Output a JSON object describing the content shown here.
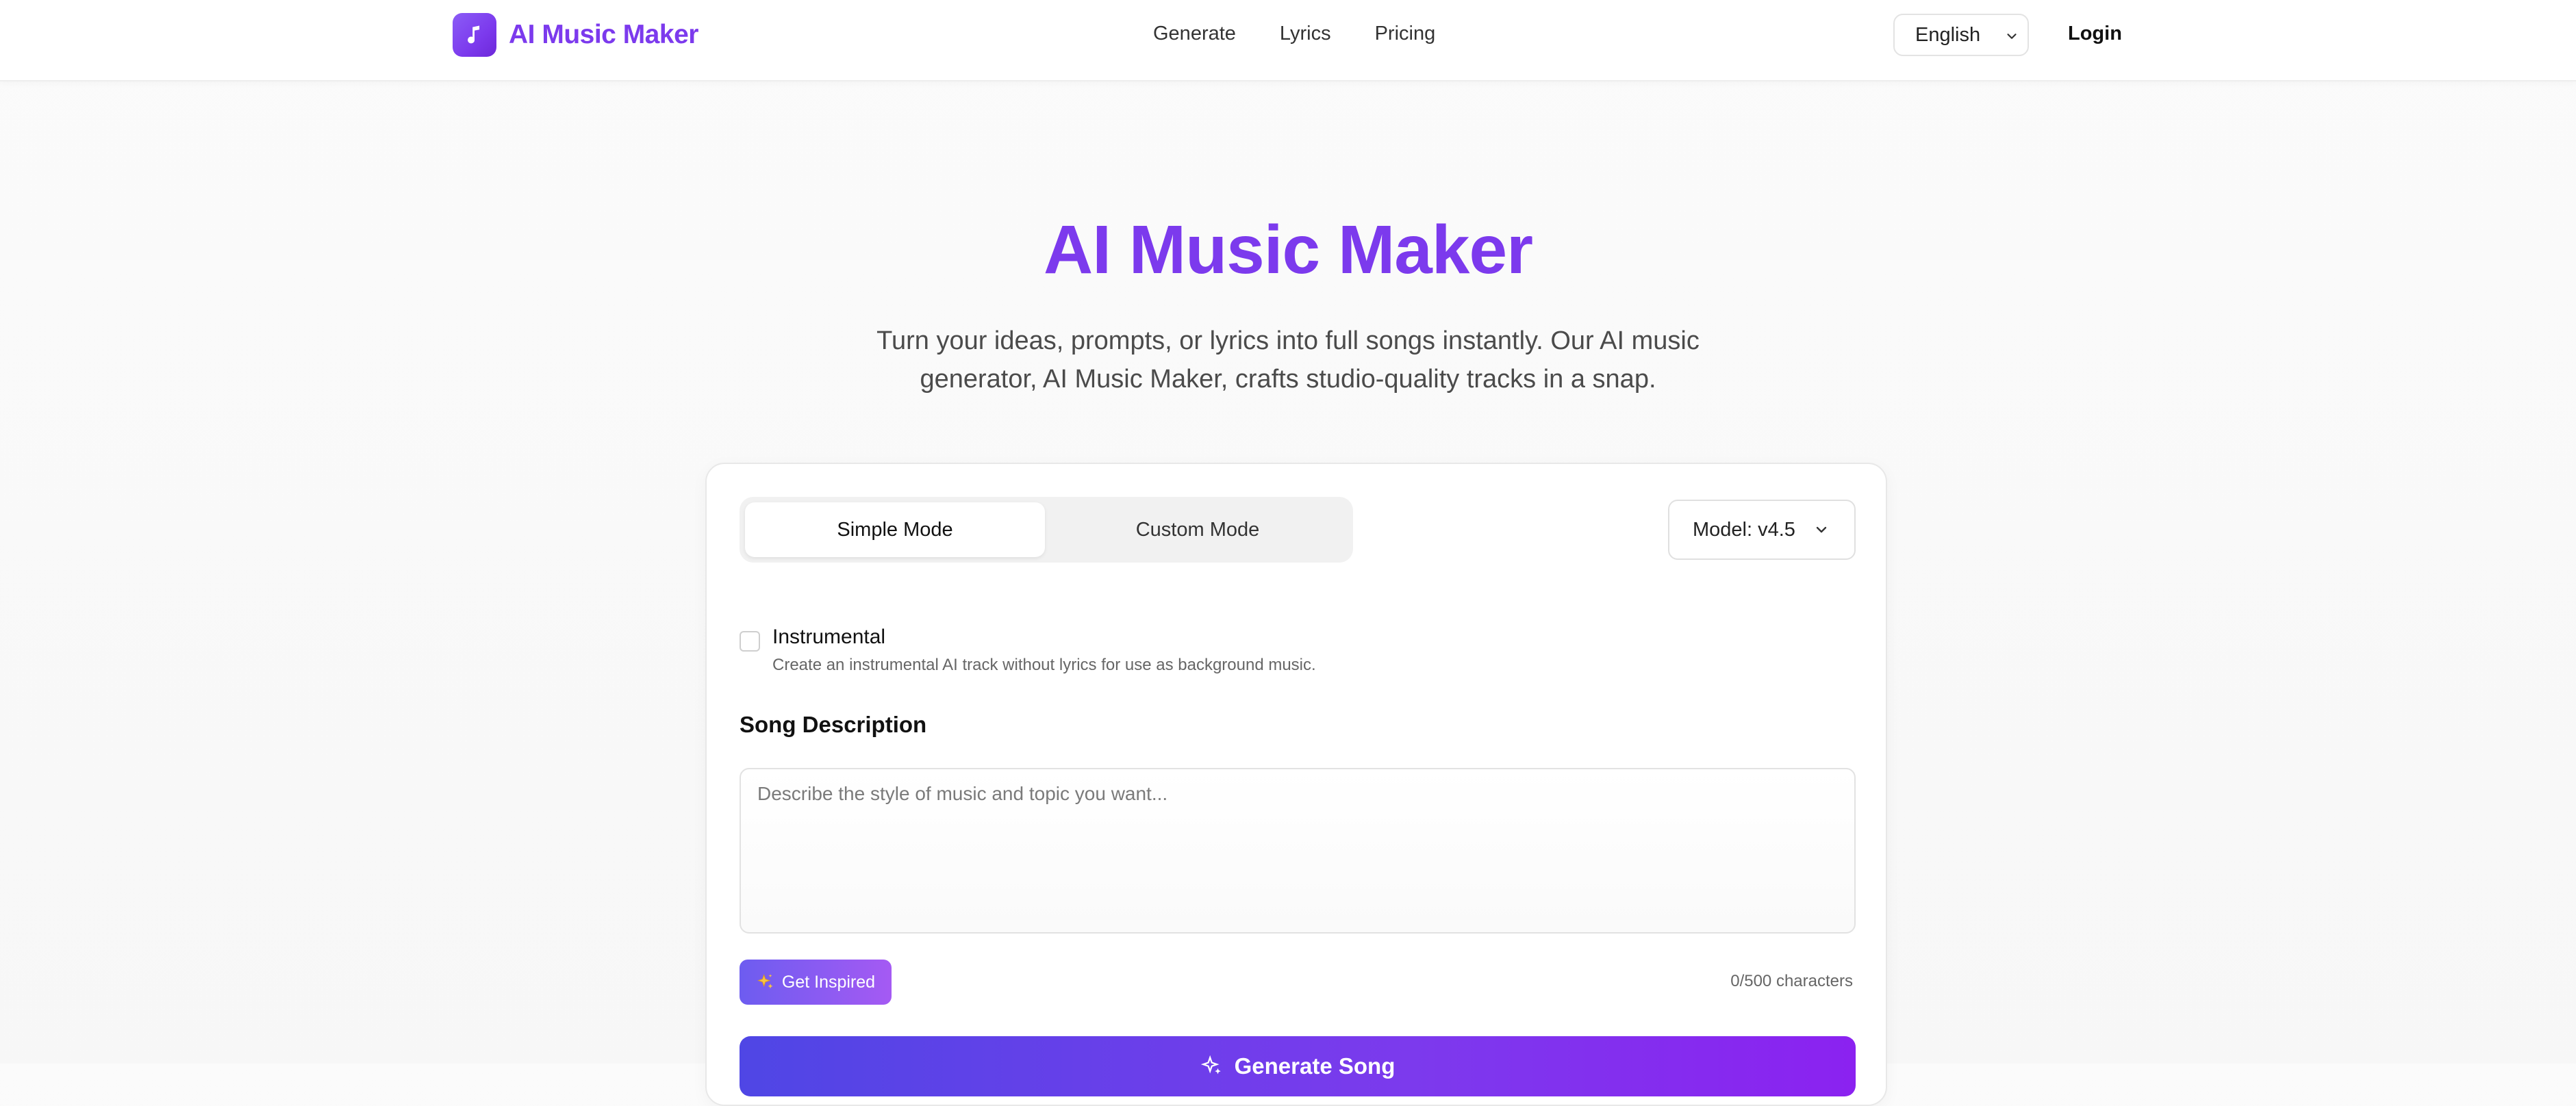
{
  "header": {
    "brand": "AI Music Maker",
    "nav": [
      {
        "label": "Generate"
      },
      {
        "label": "Lyrics"
      },
      {
        "label": "Pricing"
      }
    ],
    "language": "English",
    "login_label": "Login",
    "brand_icon": "music-note-icon"
  },
  "hero": {
    "title": "AI Music Maker",
    "subtitle": "Turn your ideas, prompts, or lyrics into full songs instantly. Our AI music generator, AI Music Maker, crafts studio-quality tracks in a snap."
  },
  "form": {
    "modes": [
      {
        "label": "Simple Mode",
        "active": true
      },
      {
        "label": "Custom Mode",
        "active": false
      }
    ],
    "model_label": "Model: v4.5",
    "instrumental": {
      "label": "Instrumental",
      "description": "Create an instrumental AI track without lyrics for use as background music.",
      "checked": false
    },
    "song_description": {
      "label": "Song Description",
      "placeholder": "Describe the style of music and topic you want...",
      "value": ""
    },
    "inspire_label": "Get Inspired",
    "char_count": "0/500 characters",
    "generate_label": "Generate Song"
  },
  "colors": {
    "brand": "#7c3aed",
    "accent_gradient_start": "#4f46e5",
    "accent_gradient_end": "#8b22f0"
  }
}
